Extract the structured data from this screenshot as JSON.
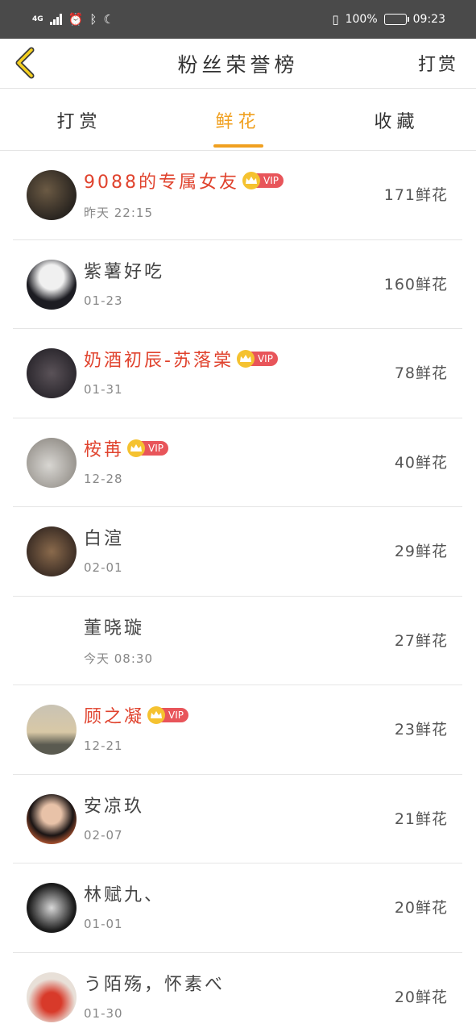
{
  "status_bar": {
    "network": "4G",
    "battery": "100%",
    "battery_level": 1.0,
    "time": "09:23"
  },
  "header": {
    "title": "粉丝荣誉榜",
    "right_action": "打赏",
    "back_icon": "chevron-left-icon"
  },
  "tabs": [
    {
      "label": "打赏",
      "active": false
    },
    {
      "label": "鲜花",
      "active": true
    },
    {
      "label": "收藏",
      "active": false
    }
  ],
  "colors": {
    "accent": "#f0a020",
    "vip_name": "#e0432e",
    "vip_tag": "#e8555a",
    "crown": "#f5c230"
  },
  "vip_label": "VIP",
  "rows": [
    {
      "name": "9088的专属女友",
      "time": "昨天 22:15",
      "amount": "171鲜花",
      "vip": true
    },
    {
      "name": "紫薯好吃",
      "time": "01-23",
      "amount": "160鲜花",
      "vip": false
    },
    {
      "name": "奶酒初辰-苏落棠",
      "time": "01-31",
      "amount": "78鲜花",
      "vip": true
    },
    {
      "name": "桉苒",
      "time": "12-28",
      "amount": "40鲜花",
      "vip": true
    },
    {
      "name": "白渲",
      "time": "02-01",
      "amount": "29鲜花",
      "vip": false
    },
    {
      "name": "董晓璇",
      "time": "今天 08:30",
      "amount": "27鲜花",
      "vip": false
    },
    {
      "name": "顾之凝",
      "time": "12-21",
      "amount": "23鲜花",
      "vip": true
    },
    {
      "name": "安凉玖",
      "time": "02-07",
      "amount": "21鲜花",
      "vip": false
    },
    {
      "name": "林赋九、",
      "time": "01-01",
      "amount": "20鲜花",
      "vip": false
    },
    {
      "name": "う陌殇，怀素べ",
      "time": "01-30",
      "amount": "20鲜花",
      "vip": false
    }
  ]
}
